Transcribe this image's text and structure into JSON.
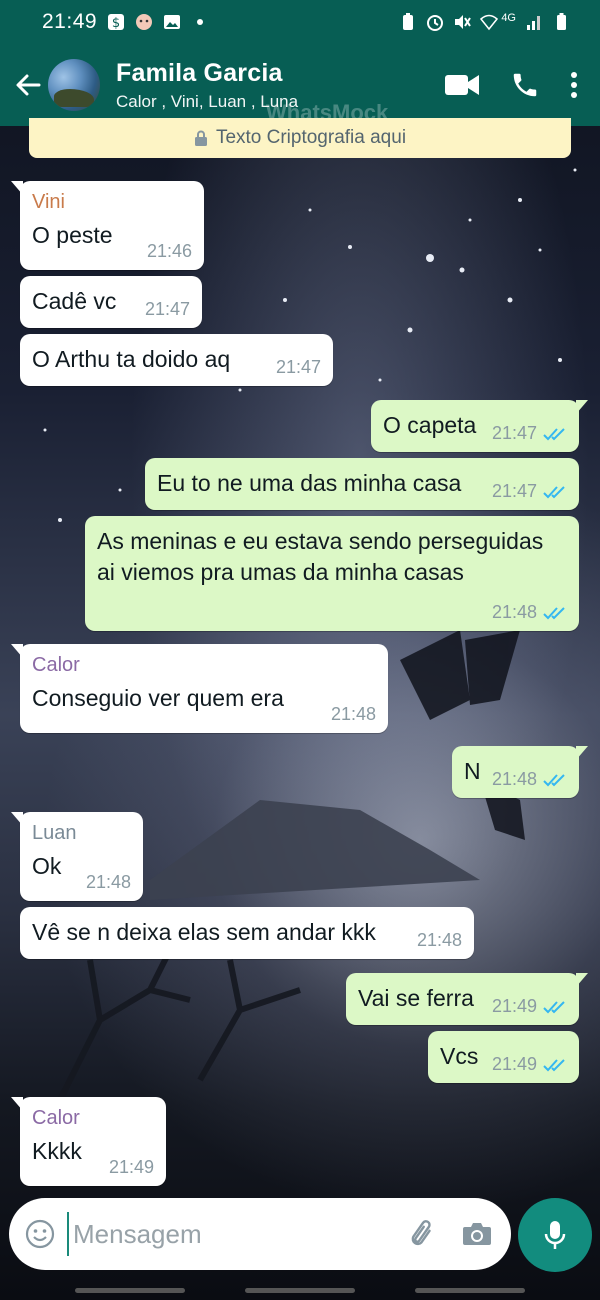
{
  "status_bar": {
    "time": "21:49",
    "network": "4G"
  },
  "header": {
    "back_icon": "arrow-left-icon",
    "title": "Famila Garcia",
    "subtitle": "Calor , Vini, Luan , Luna",
    "watermark": "WhatsMock",
    "video_icon": "video-call-icon",
    "call_icon": "phone-icon",
    "menu_icon": "more-vert-icon"
  },
  "encryption_banner": {
    "icon": "lock-icon",
    "text": "Texto Criptografia aqui"
  },
  "messages": [
    {
      "direction": "in",
      "sender": "Vini",
      "sender_color": "#c97b4b",
      "text": "O peste",
      "time": "21:46"
    },
    {
      "direction": "in",
      "sender": "",
      "text": "Cadê vc",
      "time": "21:47"
    },
    {
      "direction": "in",
      "sender": "",
      "text": "O Arthu ta doido aq",
      "time": "21:47"
    },
    {
      "direction": "out",
      "text": "O capeta",
      "time": "21:47",
      "read": true
    },
    {
      "direction": "out",
      "text": "Eu to ne uma das minha casa",
      "time": "21:47",
      "read": true
    },
    {
      "direction": "out",
      "text": "As meninas e eu estava sendo perseguidas ai viemos pra umas da minha casas",
      "time": "21:48",
      "read": true
    },
    {
      "direction": "in",
      "sender": "Calor",
      "sender_color": "#8b6aa5",
      "text": "Conseguio ver quem era",
      "time": "21:48"
    },
    {
      "direction": "out",
      "text": "N",
      "time": "21:48",
      "read": true
    },
    {
      "direction": "in",
      "sender": "Luan",
      "sender_color": "#7a8a96",
      "text": "Ok",
      "time": "21:48"
    },
    {
      "direction": "in",
      "sender": "",
      "text": "Vê se n deixa elas sem andar kkk",
      "time": "21:48"
    },
    {
      "direction": "out",
      "text": "Vai se ferra",
      "time": "21:49",
      "read": true
    },
    {
      "direction": "out",
      "text": "Vcs",
      "time": "21:49",
      "read": true
    },
    {
      "direction": "in",
      "sender": "Calor",
      "sender_color": "#8b6aa5",
      "text": "Kkkk",
      "time": "21:49"
    }
  ],
  "composer": {
    "placeholder": "Mensagem",
    "emoji_icon": "emoji-icon",
    "attach_icon": "paperclip-icon",
    "camera_icon": "camera-icon",
    "mic_icon": "microphone-icon"
  },
  "colors": {
    "header_bg": "#075e54",
    "outgoing_bubble": "#dcf8c6",
    "incoming_bubble": "#ffffff",
    "read_ticks": "#34b7f1",
    "mic_button": "#128c7e"
  }
}
